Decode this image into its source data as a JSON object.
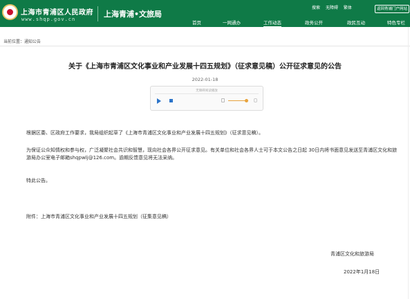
{
  "header": {
    "site_name": "上海市青浦区人民政府",
    "site_url": "www.shqp.gov.cn",
    "bureau_name": "上海青浦•文旅局",
    "tools": [
      "搜索",
      "无障碍",
      "繁体"
    ],
    "top_button": "返回青浦门户网站"
  },
  "nav": {
    "items": [
      "首页",
      "一网通办",
      "工作动态",
      "政务公开",
      "政民互动",
      "特色专栏"
    ],
    "active_index": 2
  },
  "breadcrumb": "当前位置：通知公告",
  "article": {
    "title": "关于《上海市青浦区文化事业和产业发展十四五规划》（征求意见稿）公开征求意见的公告",
    "date": "2022-01-18",
    "paragraph1": "根据区委、区政府工作要求，我局组织起草了《上海市青浦区文化事业和产业发展十四五规划》（征求意见稿）。",
    "paragraph2": "为保证公众知情权和参与权，广泛凝聚社会共识和智慧，现向社会各界公开征求意见。有关单位和社会各界人士可于本文公告之日起 30日内将书面意见发送至青浦区文化和旅游局办公室电子邮箱shqpwlj@126.com。逾期反馈意见将无法采纳。",
    "paragraph3": "特此公告。",
    "attachment": "附件：上海市青浦区文化事业和产业发展十四五规划（征集意见稿）",
    "department": "青浦区文化和旅游局",
    "sign_date": "2022年1月18日"
  },
  "player": {
    "label": "无障碍阅读播放"
  },
  "colors": {
    "header_bg": "#0f7a47",
    "player_accent": "#2c74c9",
    "volume_accent": "#e8a33d"
  }
}
